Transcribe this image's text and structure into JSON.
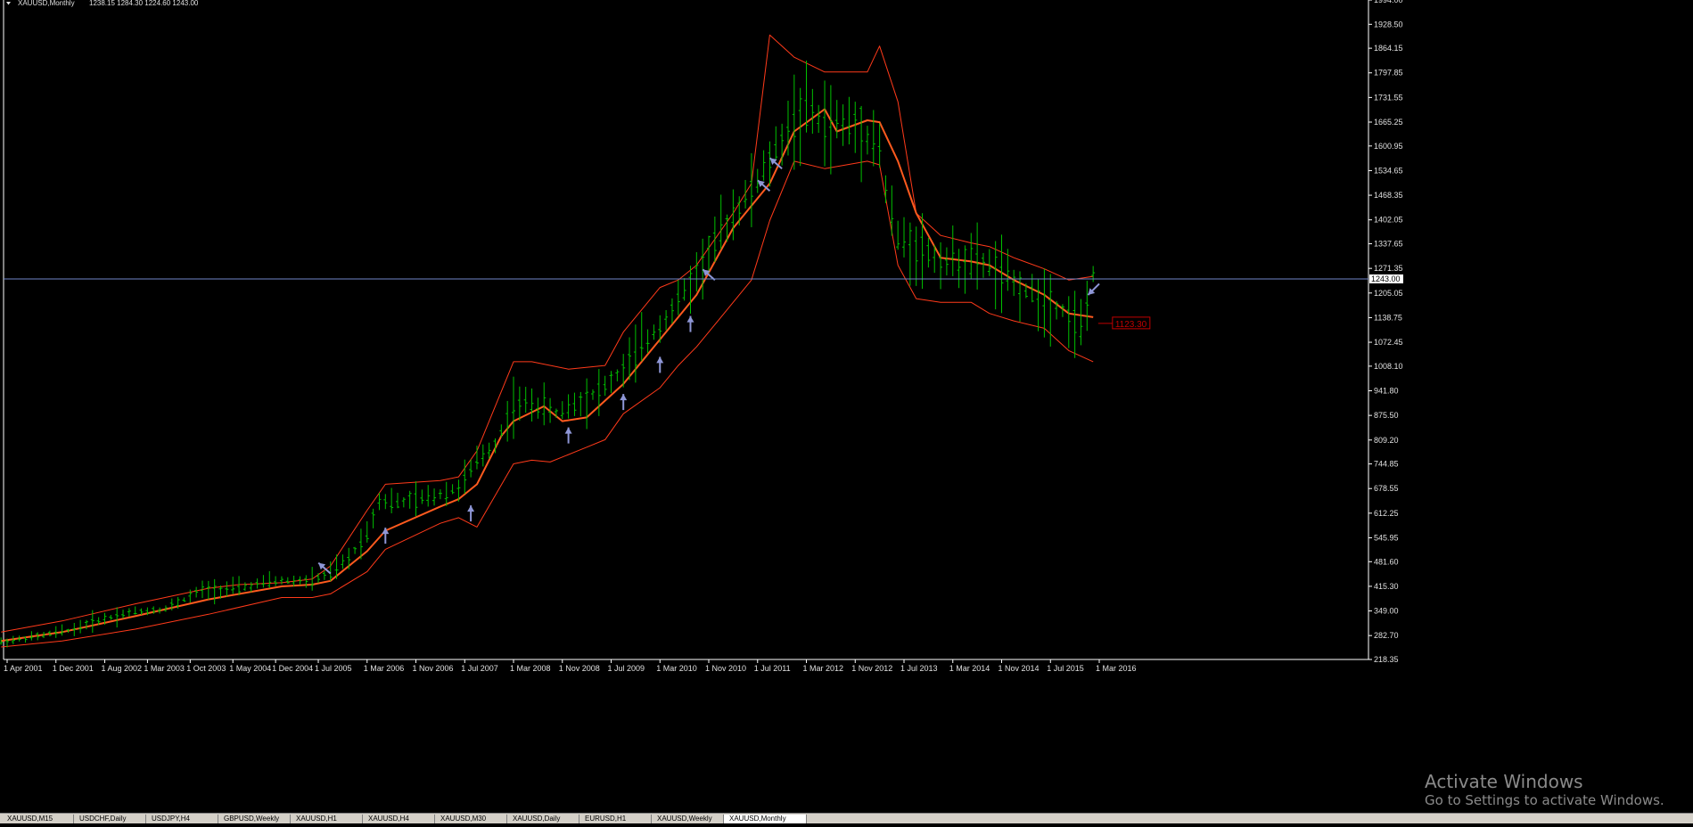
{
  "header": {
    "symbol": "XAUUSD,Monthly",
    "ohlc": "1238.15 1284.30 1224.60 1243.00"
  },
  "current_price_label": "1243.00",
  "ma_value_label": "1123.30",
  "watermark": {
    "title": "Activate Windows",
    "subtitle": "Go to Settings to activate Windows."
  },
  "colors": {
    "background": "#000000",
    "bars": "#00c000",
    "middle_band": "#ff5a1e",
    "outer_bands": "#ff3a1a",
    "price_line": "#6f86c8",
    "arrows": "#8e96d6",
    "axis_text": "#e0e0e0",
    "ma_label_box": "#c00000"
  },
  "icons": [
    "dropdown-triangle-icon",
    "arrow-up-icon"
  ],
  "chart_data": {
    "type": "bar",
    "ylim": [
      218.35,
      1994.0
    ],
    "x_dates": [
      "2001-04",
      "2001-12",
      "2002-08",
      "2003-03",
      "2003-10",
      "2004-05",
      "2004-12",
      "2005-07",
      "2006-03",
      "2006-11",
      "2007-07",
      "2008-03",
      "2008-11",
      "2009-07",
      "2010-03",
      "2010-11",
      "2011-07",
      "2012-03",
      "2012-11",
      "2013-07",
      "2014-03",
      "2014-11",
      "2015-07",
      "2016-03"
    ],
    "x_ticks": [
      "1 Apr 2001",
      "1 Dec 2001",
      "1 Aug 2002",
      "1 Mar 2003",
      "1 Oct 2003",
      "1 May 2004",
      "1 Dec 2004",
      "1 Jul 2005",
      "1 Mar 2006",
      "1 Nov 2006",
      "1 Jul 2007",
      "1 Mar 2008",
      "1 Nov 2008",
      "1 Jul 2009",
      "1 Mar 2010",
      "1 Nov 2010",
      "1 Jul 2011",
      "1 Mar 2012",
      "1 Nov 2012",
      "1 Jul 2013",
      "1 Mar 2014",
      "1 Nov 2014",
      "1 Jul 2015",
      "1 Mar 2016"
    ],
    "y_ticks": [
      "1994.00",
      "1928.50",
      "1864.15",
      "1797.85",
      "1731.55",
      "1665.25",
      "1600.95",
      "1534.65",
      "1468.35",
      "1402.05",
      "1337.65",
      "1271.35",
      "1205.05",
      "1138.75",
      "1072.45",
      "1008.10",
      "941.80",
      "875.50",
      "809.20",
      "744.85",
      "678.55",
      "612.25",
      "545.95",
      "481.60",
      "415.30",
      "349.00",
      "282.70",
      "218.35"
    ],
    "current_price": 1243.0,
    "ma_last": 1123.3,
    "path_dates": [
      "2001-03",
      "2001-09",
      "2002-03",
      "2002-06",
      "2002-12",
      "2003-06",
      "2003-12",
      "2004-06",
      "2004-12",
      "2005-06",
      "2005-09",
      "2005-12",
      "2006-03",
      "2006-05",
      "2006-08",
      "2006-12",
      "2007-06",
      "2007-09",
      "2007-12",
      "2008-03",
      "2008-06",
      "2008-10",
      "2008-12",
      "2009-06",
      "2009-09",
      "2009-12",
      "2010-03",
      "2010-06",
      "2010-09",
      "2010-12",
      "2011-03",
      "2011-06",
      "2011-09",
      "2011-12",
      "2012-03",
      "2012-06",
      "2012-09",
      "2012-12",
      "2013-03",
      "2013-04",
      "2013-06",
      "2013-09",
      "2013-12",
      "2014-03",
      "2014-06",
      "2014-09",
      "2014-12",
      "2015-03",
      "2015-06",
      "2015-09",
      "2015-12",
      "2016-02"
    ],
    "path_values": [
      265,
      280,
      300,
      320,
      345,
      355,
      405,
      410,
      430,
      430,
      450,
      490,
      560,
      650,
      640,
      650,
      680,
      750,
      800,
      900,
      910,
      880,
      900,
      950,
      1000,
      1060,
      1120,
      1180,
      1260,
      1340,
      1420,
      1480,
      1560,
      1650,
      1700,
      1660,
      1660,
      1650,
      1600,
      1480,
      1350,
      1330,
      1300,
      1290,
      1290,
      1280,
      1240,
      1210,
      1190,
      1160,
      1110,
      1250
    ],
    "middle_band_x": [
      "2001-03",
      "2002-01",
      "2003-01",
      "2004-01",
      "2005-01",
      "2005-06",
      "2005-09",
      "2006-03",
      "2006-06",
      "2007-03",
      "2007-06",
      "2007-09",
      "2008-01",
      "2008-03",
      "2008-08",
      "2008-11",
      "2009-03",
      "2009-09",
      "2010-03",
      "2010-09",
      "2011-03",
      "2011-09",
      "2012-01",
      "2012-06",
      "2012-08",
      "2013-01",
      "2013-03",
      "2013-06",
      "2013-09",
      "2014-01",
      "2014-06",
      "2014-09",
      "2015-01",
      "2015-06",
      "2015-10",
      "2016-02"
    ],
    "middle_band_y": [
      268,
      292,
      335,
      380,
      415,
      420,
      430,
      510,
      565,
      630,
      650,
      690,
      820,
      860,
      900,
      860,
      870,
      960,
      1080,
      1200,
      1380,
      1500,
      1640,
      1700,
      1640,
      1670,
      1665,
      1560,
      1420,
      1300,
      1290,
      1280,
      1240,
      1200,
      1150,
      1140
    ],
    "upper_band_x": [
      "2001-03",
      "2002-01",
      "2003-01",
      "2004-01",
      "2004-06",
      "2005-01",
      "2005-06",
      "2005-09",
      "2006-03",
      "2006-06",
      "2007-03",
      "2007-06",
      "2007-09",
      "2008-03",
      "2008-06",
      "2008-12",
      "2009-06",
      "2009-09",
      "2010-03",
      "2010-06",
      "2010-09",
      "2011-03",
      "2011-06",
      "2011-09",
      "2012-01",
      "2012-06",
      "2012-09",
      "2013-01",
      "2013-03",
      "2013-06",
      "2013-09",
      "2014-01",
      "2014-06",
      "2014-09",
      "2015-01",
      "2015-06",
      "2015-10",
      "2016-02"
    ],
    "upper_band_y": [
      292,
      322,
      368,
      410,
      420,
      425,
      435,
      470,
      620,
      690,
      700,
      710,
      780,
      1020,
      1020,
      1000,
      1010,
      1100,
      1220,
      1240,
      1280,
      1420,
      1500,
      1900,
      1840,
      1800,
      1800,
      1800,
      1870,
      1720,
      1420,
      1360,
      1340,
      1330,
      1300,
      1270,
      1240,
      1250
    ],
    "lower_band_x": [
      "2001-03",
      "2002-01",
      "2003-01",
      "2004-01",
      "2005-01",
      "2005-06",
      "2005-09",
      "2006-03",
      "2006-06",
      "2007-03",
      "2007-06",
      "2007-09",
      "2008-03",
      "2008-06",
      "2008-09",
      "2009-03",
      "2009-06",
      "2009-09",
      "2010-03",
      "2010-06",
      "2010-09",
      "2011-01",
      "2011-06",
      "2011-09",
      "2012-01",
      "2012-06",
      "2013-01",
      "2013-03",
      "2013-06",
      "2013-09",
      "2014-01",
      "2014-06",
      "2014-09",
      "2015-01",
      "2015-06",
      "2015-10",
      "2016-02"
    ],
    "lower_band_y": [
      252,
      268,
      300,
      340,
      385,
      385,
      395,
      455,
      515,
      585,
      600,
      575,
      745,
      755,
      750,
      790,
      810,
      880,
      950,
      1010,
      1060,
      1140,
      1240,
      1400,
      1560,
      1540,
      1560,
      1550,
      1280,
      1190,
      1180,
      1180,
      1150,
      1130,
      1110,
      1050,
      1020
    ],
    "arrows": [
      {
        "date": "2005-09",
        "value": 450,
        "dir": "up-left"
      },
      {
        "date": "2006-06",
        "value": 530,
        "dir": "up"
      },
      {
        "date": "2007-08",
        "value": 590,
        "dir": "up"
      },
      {
        "date": "2008-12",
        "value": 800,
        "dir": "up"
      },
      {
        "date": "2009-09",
        "value": 890,
        "dir": "up"
      },
      {
        "date": "2010-03",
        "value": 990,
        "dir": "up"
      },
      {
        "date": "2010-08",
        "value": 1100,
        "dir": "up"
      },
      {
        "date": "2010-12",
        "value": 1240,
        "dir": "up-left"
      },
      {
        "date": "2011-09",
        "value": 1480,
        "dir": "up-left"
      },
      {
        "date": "2011-11",
        "value": 1540,
        "dir": "up-left"
      },
      {
        "date": "2016-03",
        "value": 1230,
        "dir": "down-left"
      }
    ]
  },
  "tab_bar": {
    "tabs": [
      "XAUUSD,M15",
      "USDCHF,Daily",
      "USDJPY,H4",
      "GBPUSD,Weekly",
      "XAUUSD,H1",
      "XAUUSD,H4",
      "XAUUSD,M30",
      "XAUUSD,Daily",
      "EURUSD,H1",
      "XAUUSD,Weekly",
      "XAUUSD,Monthly"
    ]
  }
}
